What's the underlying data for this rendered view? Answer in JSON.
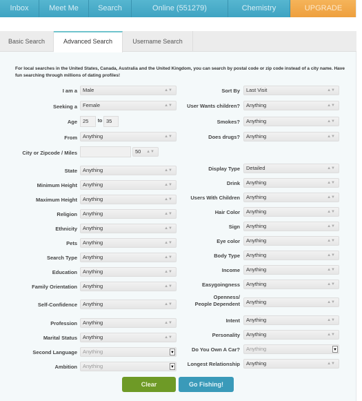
{
  "nav": {
    "items": [
      {
        "label": "Inbox"
      },
      {
        "label": "Meet Me"
      },
      {
        "label": "Search"
      },
      {
        "label": "Online (551279)"
      },
      {
        "label": "Chemistry"
      },
      {
        "label": "UPGRADE"
      }
    ]
  },
  "tabs": [
    {
      "label": "Basic Search",
      "active": false
    },
    {
      "label": "Advanced Search",
      "active": true
    },
    {
      "label": "Username Search",
      "active": false
    }
  ],
  "intro": "For local searches in the United States, Canada, Australia and the United Kingdom, you can search by postal code or zip code instead of a city name. Have fun searching through millions of dating profiles!",
  "form": {
    "i_am_a": {
      "label": "I am a",
      "value": "Male"
    },
    "seeking_a": {
      "label": "Seeking a",
      "value": "Female"
    },
    "age": {
      "label": "Age",
      "from": "25",
      "to_label": "to",
      "to": "35"
    },
    "from": {
      "label": "From",
      "value": "Anything"
    },
    "city": {
      "label": "City or Zipcode / Miles",
      "value": "",
      "miles": "50"
    },
    "state": {
      "label": "State",
      "value": "Anything"
    },
    "min_height": {
      "label": "Minimum Height",
      "value": "Anything"
    },
    "max_height": {
      "label": "Maximum Height",
      "value": "Anything"
    },
    "religion": {
      "label": "Religion",
      "value": "Anything"
    },
    "ethnicity": {
      "label": "Ethnicity",
      "value": "Anything"
    },
    "pets": {
      "label": "Pets",
      "value": "Anything"
    },
    "search_type": {
      "label": "Search Type",
      "value": "Anything"
    },
    "education": {
      "label": "Education",
      "value": "Anything"
    },
    "family_orientation": {
      "label": "Family Orientation",
      "value": "Anything"
    },
    "self_confidence": {
      "label": "Self-Confidence",
      "value": "Anything"
    },
    "profession": {
      "label": "Profession",
      "value": "Anything"
    },
    "marital_status": {
      "label": "Marital Status",
      "value": "Anything"
    },
    "second_language": {
      "label": "Second Language",
      "value": "Anything"
    },
    "ambition": {
      "label": "Ambition",
      "value": "Anything"
    },
    "sort_by": {
      "label": "Sort By",
      "value": "Last Visit"
    },
    "wants_children": {
      "label": "User Wants children?",
      "value": "Anything"
    },
    "smokes": {
      "label": "Smokes?",
      "value": "Anything"
    },
    "drugs": {
      "label": "Does drugs?",
      "value": "Anything"
    },
    "display_type": {
      "label": "Display Type",
      "value": "Detailed"
    },
    "drink": {
      "label": "Drink",
      "value": "Anything"
    },
    "with_children": {
      "label": "Users With Children",
      "value": "Anything"
    },
    "hair_color": {
      "label": "Hair Color",
      "value": "Anything"
    },
    "sign": {
      "label": "Sign",
      "value": "Anything"
    },
    "eye_color": {
      "label": "Eye color",
      "value": "Anything"
    },
    "body_type": {
      "label": "Body Type",
      "value": "Anything"
    },
    "income": {
      "label": "Income",
      "value": "Anything"
    },
    "easygoingness": {
      "label": "Easygoingness",
      "value": "Anything"
    },
    "openness": {
      "label_line1": "Openness/",
      "label_line2": "People Dependent",
      "value": "Anything"
    },
    "intent": {
      "label": "Intent",
      "value": "Anything"
    },
    "personality": {
      "label": "Personality",
      "value": "Anything"
    },
    "own_car": {
      "label": "Do You Own A Car?",
      "value": "Anything"
    },
    "longest_relationship": {
      "label": "Longest Relationship",
      "value": "Anything"
    }
  },
  "buttons": {
    "clear": "Clear",
    "go": "Go Fishing!"
  }
}
